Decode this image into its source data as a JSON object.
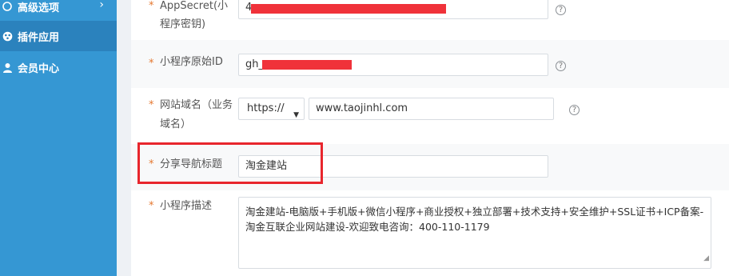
{
  "sidebar": {
    "items": [
      {
        "label": "高级选项",
        "icon": "advanced-options-icon",
        "chevron": "›"
      },
      {
        "label": "插件应用",
        "icon": "plugin-icon"
      },
      {
        "label": "会员中心",
        "icon": "user-icon"
      }
    ]
  },
  "form": {
    "required_mark": "*",
    "app_secret": {
      "label_line1": "AppSecret(小",
      "label_line2": "程序密钥)",
      "value_prefix": "4"
    },
    "original_id": {
      "label": "小程序原始ID",
      "value_prefix": "gh_"
    },
    "domain": {
      "label_line1": "网站域名（业务",
      "label_line2": "域名）",
      "protocol": "https://",
      "value": "www.taojinhl.com"
    },
    "share_title": {
      "label": "分享导航标题",
      "value": "淘金建站"
    },
    "description": {
      "label": "小程序描述",
      "value": "淘金建站-电脑版+手机版+微信小程序+商业授权+独立部署+技术支持+安全维护+SSL证书+ICP备案-淘金互联企业网站建设-欢迎致电咨询：400-110-1179"
    }
  },
  "help_glyph": "?",
  "colors": {
    "sidebar": "#3597d3",
    "required": "#e5772f",
    "highlight": "#e8262d",
    "redaction": "#f0323a"
  }
}
